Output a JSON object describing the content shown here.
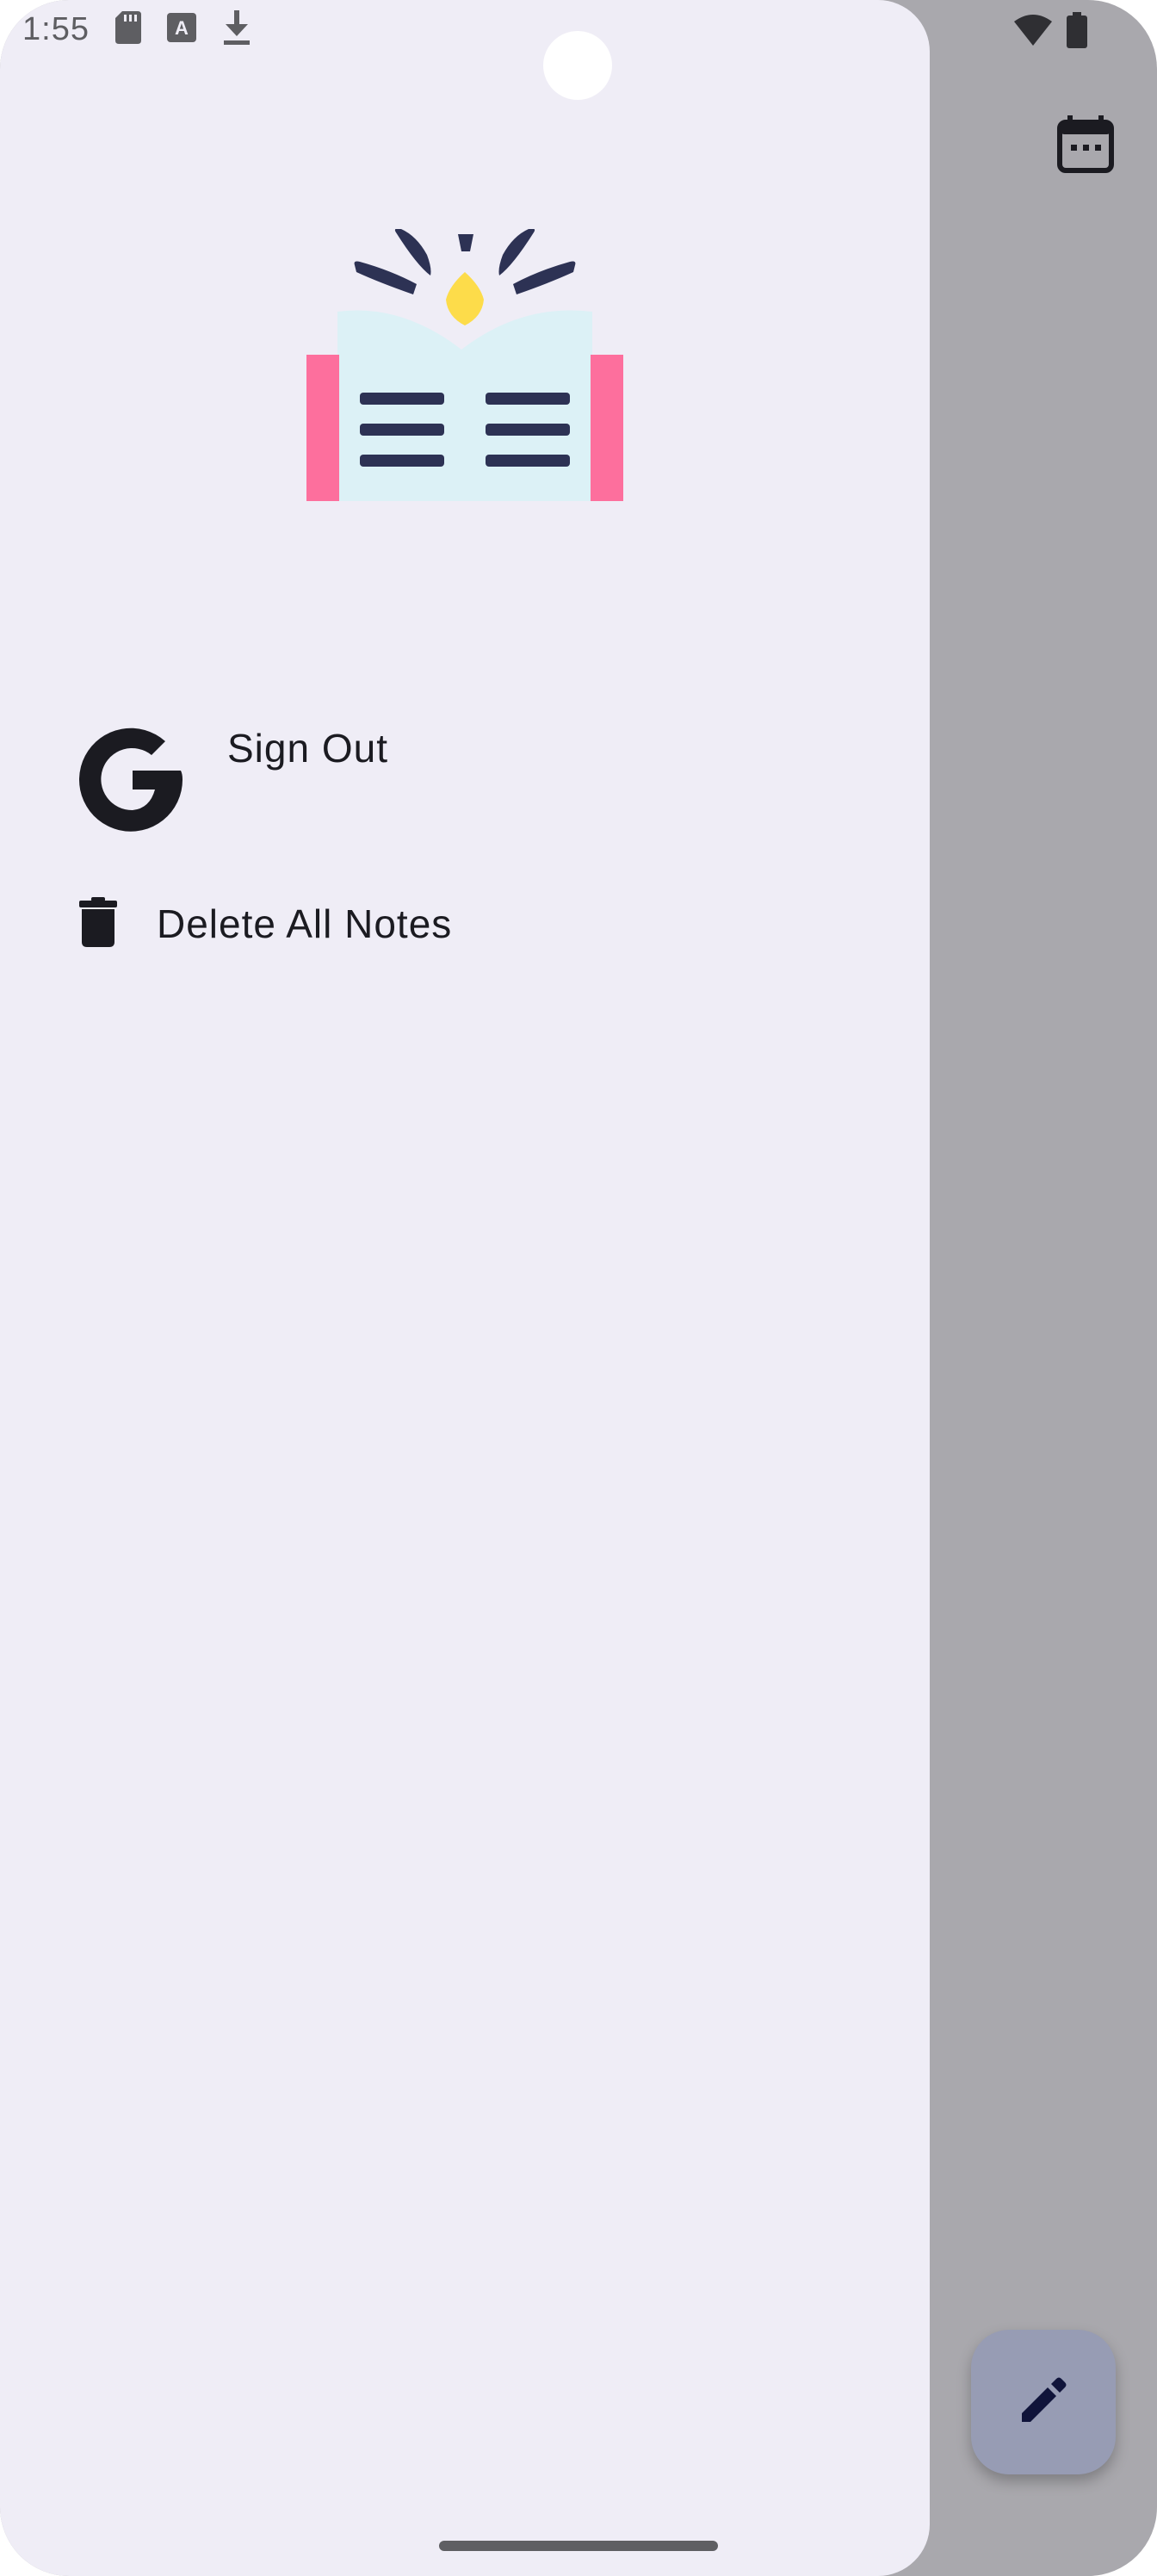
{
  "status_bar": {
    "time": "1:55",
    "icons": [
      "sd-card-icon",
      "font-download-icon",
      "download-icon",
      "wifi-icon",
      "battery-icon"
    ]
  },
  "drawer": {
    "logo_icon": "open-book-icon",
    "items": [
      {
        "label": "Sign Out",
        "icon": "google-g-icon"
      },
      {
        "label": "Delete All Notes",
        "icon": "trash-icon"
      }
    ]
  },
  "background_app": {
    "calendar_icon": "calendar-icon",
    "fab_icon": "edit-pencil-icon"
  },
  "colors": {
    "drawer_bg": "#efedf6",
    "scrim": "#a9a8ad",
    "fab": "#979cb4",
    "text": "#1b1b21",
    "book_page": "#dcf1f6",
    "book_cover": "#fd6f9d",
    "book_lines": "#2d3254",
    "bulb": "#fddc4a"
  }
}
